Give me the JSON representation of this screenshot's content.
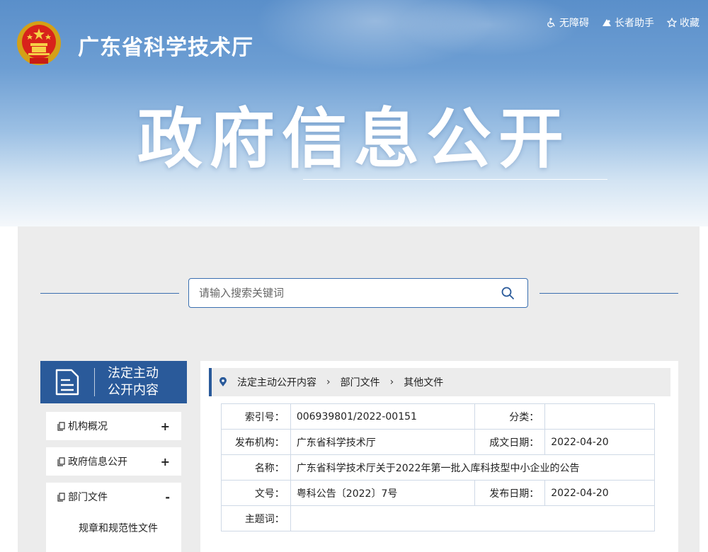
{
  "header": {
    "site_name": "广东省科学技术厅",
    "title": "政府信息公开",
    "links": [
      {
        "label": "无障碍",
        "icon": "accessibility-icon"
      },
      {
        "label": "长者助手",
        "icon": "elder-helper-icon"
      },
      {
        "label": "收藏",
        "icon": "star-icon"
      }
    ]
  },
  "search": {
    "placeholder": "请输入搜索关键词"
  },
  "sidebar": {
    "title_line1": "法定主动",
    "title_line2": "公开内容",
    "items": [
      {
        "label": "机构概况",
        "toggle": "+"
      },
      {
        "label": "政府信息公开",
        "toggle": "+"
      },
      {
        "label": "部门文件",
        "toggle": "-"
      }
    ],
    "sub_items": [
      "规章和规范性文件"
    ]
  },
  "breadcrumb": [
    "法定主动公开内容",
    "部门文件",
    "其他文件"
  ],
  "breadcrumb_sep": "›",
  "info": {
    "index_label": "索引号：",
    "index_value": "006939801/2022-00151",
    "category_label": "分类：",
    "category_value": "",
    "publisher_label": "发布机构：",
    "publisher_value": "广东省科学技术厅",
    "created_label": "成文日期：",
    "created_value": "2022-04-20",
    "name_label": "名称：",
    "name_value": "广东省科学技术厅关于2022年第一批入库科技型中小企业的公告",
    "docno_label": "文号：",
    "docno_value": "粤科公告〔2022〕7号",
    "published_label": "发布日期：",
    "published_value": "2022-04-20",
    "keywords_label": "主题词：",
    "keywords_value": ""
  },
  "colors": {
    "primary": "#2a5a9a",
    "panel": "#ececec"
  }
}
